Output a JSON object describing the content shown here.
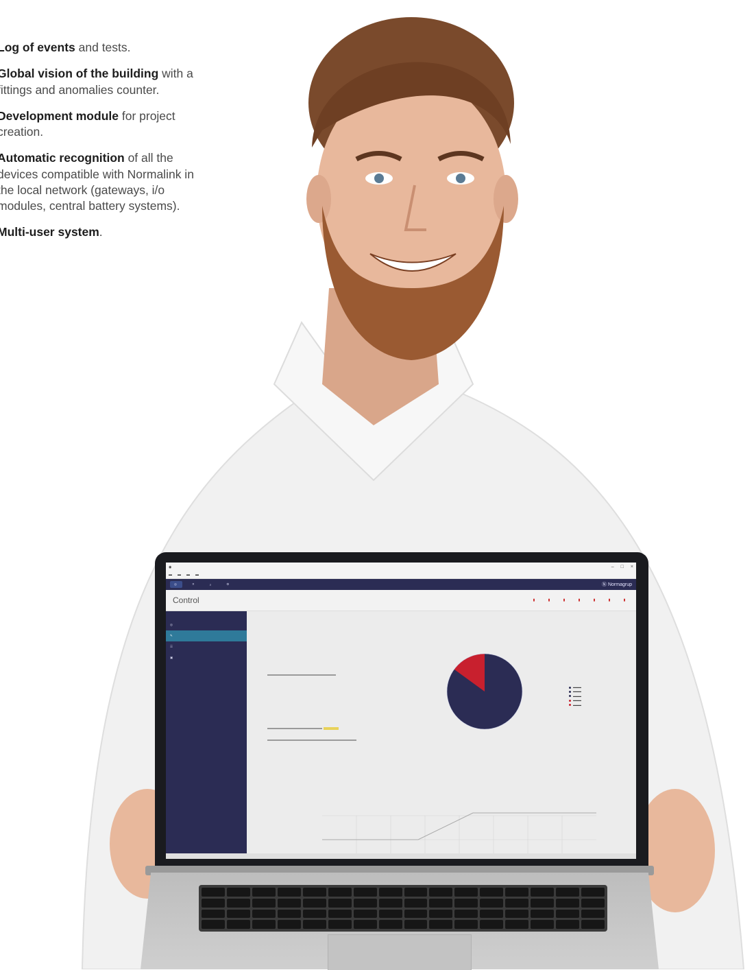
{
  "features": [
    {
      "bold": "Log of events",
      "rest": " and tests."
    },
    {
      "bold": "Global vision of the building",
      "rest": " with a fittings and anomalies counter."
    },
    {
      "bold": "Development module",
      "rest": " for project creation."
    },
    {
      "bold": "Automatic recognition",
      "rest": " of all the devices compatible with Normalink in the local network (gateways, i/o modules, central battery systems)."
    },
    {
      "bold": "Multi-user system",
      "rest": "."
    }
  ],
  "app": {
    "page_title": "Control",
    "brand": "Normagrup",
    "toolbar_buttons": [
      "",
      "",
      "",
      ""
    ],
    "sidebar_items": [
      "",
      "",
      "",
      ""
    ],
    "pie_label_big": "",
    "pie_label_small": "",
    "series": [
      {
        "name": "",
        "color": "#1f77b4"
      },
      {
        "name": "",
        "color": "#2ca02c"
      },
      {
        "name": "",
        "color": "#ff9f00"
      },
      {
        "name": "",
        "color": "#2b2c54"
      }
    ]
  },
  "colors": {
    "navy": "#2b2c54",
    "pie_main": "#2b2c54",
    "pie_red": "#c8202e",
    "accent_teal": "#2f7a9a"
  },
  "pie_share": {
    "main": 0.85,
    "red": 0.15
  }
}
